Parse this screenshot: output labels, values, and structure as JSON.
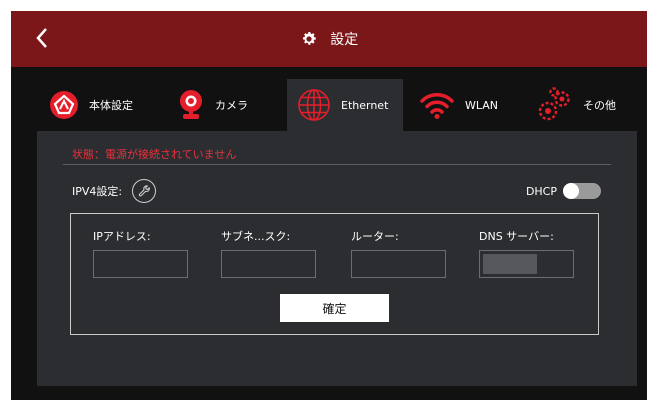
{
  "header": {
    "back_icon": "chevron-left-icon",
    "title": "設定",
    "title_icon": "gear-icon",
    "bg_color": "#7b1719"
  },
  "tabs": [
    {
      "label": "本体設定",
      "icon": "logo-badge-icon",
      "active": false
    },
    {
      "label": "カメラ",
      "icon": "webcam-icon",
      "active": false
    },
    {
      "label": "Ethernet",
      "icon": "globe-icon",
      "active": true
    },
    {
      "label": "WLAN",
      "icon": "wifi-icon",
      "active": false
    },
    {
      "label": "その他",
      "icon": "gears-icon",
      "active": false
    }
  ],
  "panel": {
    "status": "状態：電源が接続されていません",
    "status_color": "#e8323c",
    "ipv4_label": "IPV4設定:",
    "dhcp_label": "DHCP",
    "dhcp_on": false,
    "fields": [
      {
        "label": "IPアドレス:",
        "value": ""
      },
      {
        "label": "サブネ...スク:",
        "value": ""
      },
      {
        "label": "ルーター:",
        "value": ""
      },
      {
        "label": "DNS サーバー:",
        "value": ""
      }
    ],
    "confirm_label": "確定"
  }
}
